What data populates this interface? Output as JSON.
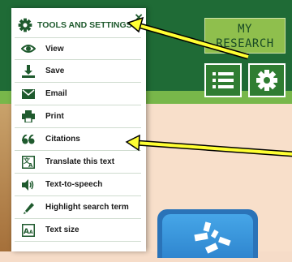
{
  "panel": {
    "title": "TOOLS AND SETTINGS",
    "close_label": "×",
    "items": [
      {
        "label": "View",
        "icon": "eye-icon"
      },
      {
        "label": "Save",
        "icon": "download-icon"
      },
      {
        "label": "Email",
        "icon": "envelope-icon"
      },
      {
        "label": "Print",
        "icon": "printer-icon"
      },
      {
        "label": "Citations",
        "icon": "quote-icon"
      },
      {
        "label": "Translate this text",
        "icon": "translate-icon"
      },
      {
        "label": "Text-to-speech",
        "icon": "speaker-icon"
      },
      {
        "label": "Highlight search term",
        "icon": "highlighter-icon"
      },
      {
        "label": "Text size",
        "icon": "text-size-icon"
      }
    ]
  },
  "header": {
    "my_research_line1": "MY",
    "my_research_line2": "RESEARCH"
  },
  "colors": {
    "header_green": "#1f6b36",
    "accent_green": "#2f7d32",
    "arrow_yellow": "#ffff33"
  }
}
